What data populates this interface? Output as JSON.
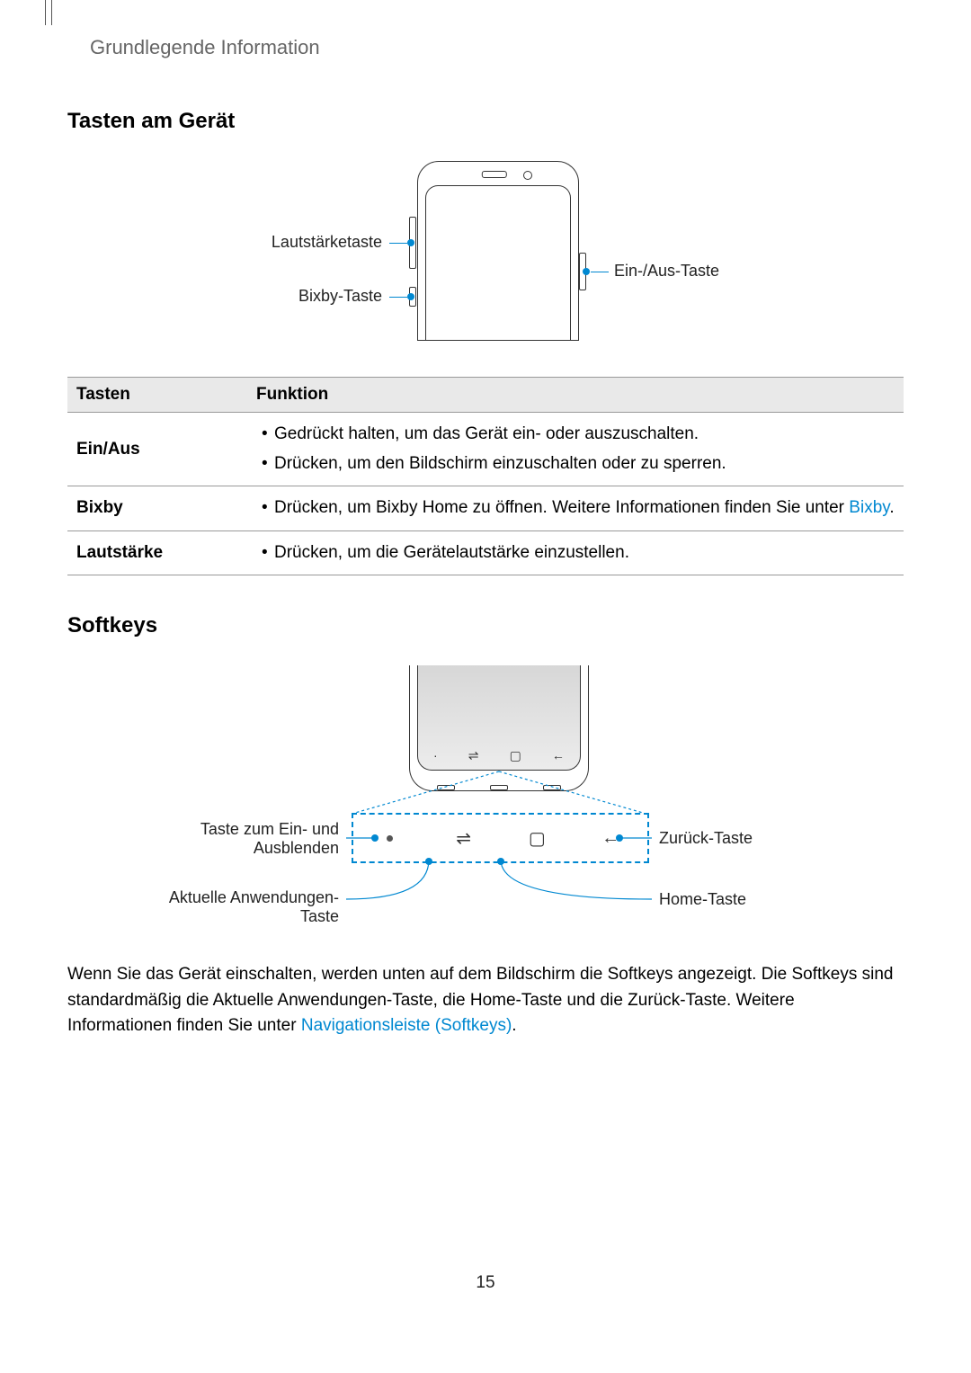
{
  "header": {
    "breadcrumb": "Grundlegende Information"
  },
  "section1": {
    "title": "Tasten am Gerät",
    "labels": {
      "volume": "Lautstärketaste",
      "bixby": "Bixby-Taste",
      "power": "Ein-/Aus-Taste"
    }
  },
  "table": {
    "col1": "Tasten",
    "col2": "Funktion",
    "rows": [
      {
        "key": "Ein/Aus",
        "items": [
          {
            "text": "Gedrückt halten, um das Gerät ein- oder auszuschalten."
          },
          {
            "text": "Drücken, um den Bildschirm einzuschalten oder zu sperren."
          }
        ]
      },
      {
        "key": "Bixby",
        "items": [
          {
            "pre": "Drücken, um Bixby Home zu öffnen. Weitere Informationen finden Sie unter ",
            "link": "Bixby",
            "post": "."
          }
        ]
      },
      {
        "key": "Lautstärke",
        "items": [
          {
            "text": "Drücken, um die Gerätelautstärke einzustellen."
          }
        ]
      }
    ]
  },
  "section2": {
    "title": "Softkeys",
    "labels": {
      "hide": "Taste zum Ein- und Ausblenden",
      "recent": "Aktuelle Anwendungen-Taste",
      "back": "Zurück-Taste",
      "home": "Home-Taste"
    },
    "glyphs": {
      "recent": "⇌",
      "home": "▢",
      "back": "←"
    }
  },
  "body": {
    "pre": "Wenn Sie das Gerät einschalten, werden unten auf dem Bildschirm die Softkeys angezeigt. Die Softkeys sind standardmäßig die Aktuelle Anwendungen-Taste, die Home-Taste und die Zurück-Taste. Weitere Informationen finden Sie unter ",
    "link": "Navigationsleiste (Softkeys)",
    "post": "."
  },
  "page_number": "15"
}
